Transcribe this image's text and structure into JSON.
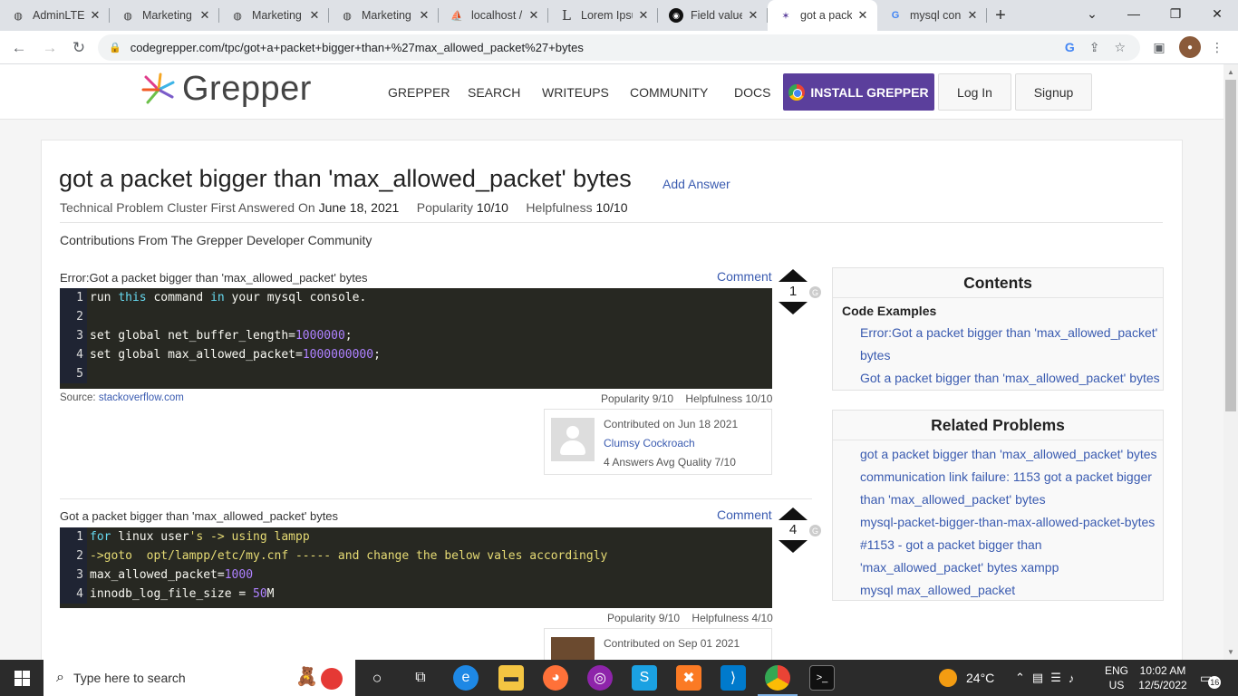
{
  "browser": {
    "tabs": [
      {
        "title": "AdminLTE",
        "icon": "globe-icon"
      },
      {
        "title": "Marketing",
        "icon": "globe-icon"
      },
      {
        "title": "Marketing",
        "icon": "globe-icon"
      },
      {
        "title": "Marketing",
        "icon": "globe-icon"
      },
      {
        "title": "localhost /",
        "icon": "phpmyadmin-icon"
      },
      {
        "title": "Lorem Ipsu",
        "icon": "lorem-icon"
      },
      {
        "title": "Field value",
        "icon": "github-icon"
      },
      {
        "title": "got a pack",
        "icon": "grepper-icon"
      },
      {
        "title": "mysql con",
        "icon": "google-icon"
      }
    ],
    "url": "codegrepper.com/tpc/got+a+packet+bigger+than+%27max_allowed_packet%27+bytes"
  },
  "site": {
    "logo": "Grepper",
    "nav": [
      "GREPPER",
      "SEARCH",
      "WRITEUPS",
      "COMMUNITY",
      "DOCS"
    ],
    "install": "INSTALL GREPPER",
    "login": "Log In",
    "signup": "Signup"
  },
  "page": {
    "title": "got a packet bigger than 'max_allowed_packet' bytes",
    "add_answer": "Add Answer",
    "meta": {
      "cluster": "Technical Problem Cluster First Answered On",
      "date": "June 18, 2021",
      "popularity_label": "Popularity",
      "popularity": "10/10",
      "helpfulness_label": "Helpfulness",
      "helpfulness": "10/10"
    },
    "contributions": "Contributions From The Grepper Developer Community"
  },
  "answers": [
    {
      "title": "Error:Got a packet bigger than 'max_allowed_packet' bytes",
      "comment": "Comment",
      "votes": "1",
      "source_label": "Source:",
      "source": "stackoverflow.com",
      "popularity": "Popularity 9/10",
      "helpfulness": "Helpfulness 10/10",
      "contributed": "Contributed on Jun 18 2021",
      "author": "Clumsy Cockroach",
      "author_stats": "4 Answers  Avg Quality 7/10"
    },
    {
      "title": "Got a packet bigger than 'max_allowed_packet' bytes",
      "comment": "Comment",
      "votes": "4",
      "popularity": "Popularity 9/10",
      "helpfulness": "Helpfulness 4/10",
      "contributed": "Contributed on Sep 01 2021"
    }
  ],
  "code": {
    "block1_lines": [
      "1",
      "2",
      "3",
      "4",
      "5"
    ],
    "block2_lines": [
      "1",
      "2",
      "3",
      "4"
    ],
    "b1": {
      "l1a": "run ",
      "l1b": "this",
      "l1c": " command ",
      "l1d": "in",
      "l1e": " your mysql console.",
      "l3a": "set global net_buffer_length=",
      "l3b": "1000000",
      "l3c": ";",
      "l4a": "set global max_allowed_packet=",
      "l4b": "1000000000",
      "l4c": ";"
    },
    "b2": {
      "l1a": "for",
      "l1b": " linux user",
      "l1c": "'s -> ",
      "l1d": "using",
      "l1e": " lampp",
      "l2": "->goto  opt/lampp/etc/my.cnf ----- and change the below vales accordingly",
      "l3a": "max_allowed_packet=",
      "l3b": "1000",
      "l4a": "innodb_log_file_size = ",
      "l4b": "50",
      "l4c": "M"
    }
  },
  "sidebar": {
    "contents_title": "Contents",
    "code_examples": "Code Examples",
    "contents_links": [
      "Error:Got a packet bigger than 'max_allowed_packet'",
      "bytes",
      "Got a packet bigger than 'max_allowed_packet' bytes"
    ],
    "related_title": "Related Problems",
    "related_links": [
      "got a packet bigger than 'max_allowed_packet' bytes",
      "communication link failure: 1153 got a packet bigger",
      "than 'max_allowed_packet' bytes",
      "mysql-packet-bigger-than-max-allowed-packet-bytes",
      "#1153 - got a packet bigger than",
      "'max_allowed_packet' bytes xampp",
      "mysql max_allowed_packet"
    ]
  },
  "taskbar": {
    "search_placeholder": "Type here to search",
    "weather": "24°C",
    "lang1": "ENG",
    "lang2": "US",
    "time": "10:02 AM",
    "date": "12/5/2022",
    "notifications": "16"
  },
  "colors": {
    "accent": "#5b3f9c",
    "link": "#3a5bb0",
    "code_bg": "#272822"
  }
}
